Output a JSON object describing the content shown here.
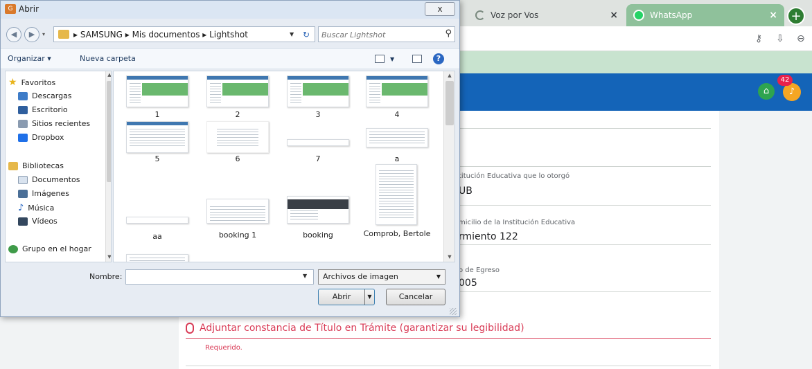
{
  "browser": {
    "tabs": [
      {
        "title": "Voz por Vos",
        "close": "×"
      },
      {
        "title": "WhatsApp",
        "close": "×"
      }
    ],
    "new_tab": "+",
    "toolbar_icons": [
      "key-icon",
      "install-icon",
      "zoom-icon"
    ],
    "notifications_count": "42"
  },
  "form": {
    "fields": [
      {
        "label": "titución Educativa que lo otorgó",
        "value": "UB"
      },
      {
        "label": "micilio de la Institución Educativa",
        "value": "rmiento 122"
      },
      {
        "label": "o de Egreso",
        "value": "005"
      }
    ],
    "attach_label": "Adjuntar constancia de Título en Trámite (garantizar su legibilidad)",
    "required_text": "Requerido.",
    "accent_color": "#d93b56"
  },
  "dialog": {
    "title": "Abrir",
    "close": "x",
    "breadcrumb": "▸ SAMSUNG ▸ Mis documentos ▸ Lightshot",
    "search_placeholder": "Buscar Lightshot",
    "toolbar": {
      "organize": "Organizar ▾",
      "new_folder": "Nueva carpeta"
    },
    "nav": {
      "favorites": "Favoritos",
      "items": [
        "Descargas",
        "Escritorio",
        "Sitios recientes",
        "Dropbox"
      ],
      "libraries": "Bibliotecas",
      "library_items": [
        "Documentos",
        "Imágenes",
        "Música",
        "Vídeos"
      ],
      "homegroup": "Grupo en el hogar"
    },
    "files": [
      "1",
      "2",
      "3",
      "4",
      "5",
      "6",
      "7",
      "a",
      "aa",
      "booking 1",
      "booking",
      "Comprob, Bertole"
    ],
    "name_label": "Nombre:",
    "name_value": "",
    "file_type": "Archivos de imagen",
    "open_button": "Abrir",
    "cancel_button": "Cancelar"
  }
}
